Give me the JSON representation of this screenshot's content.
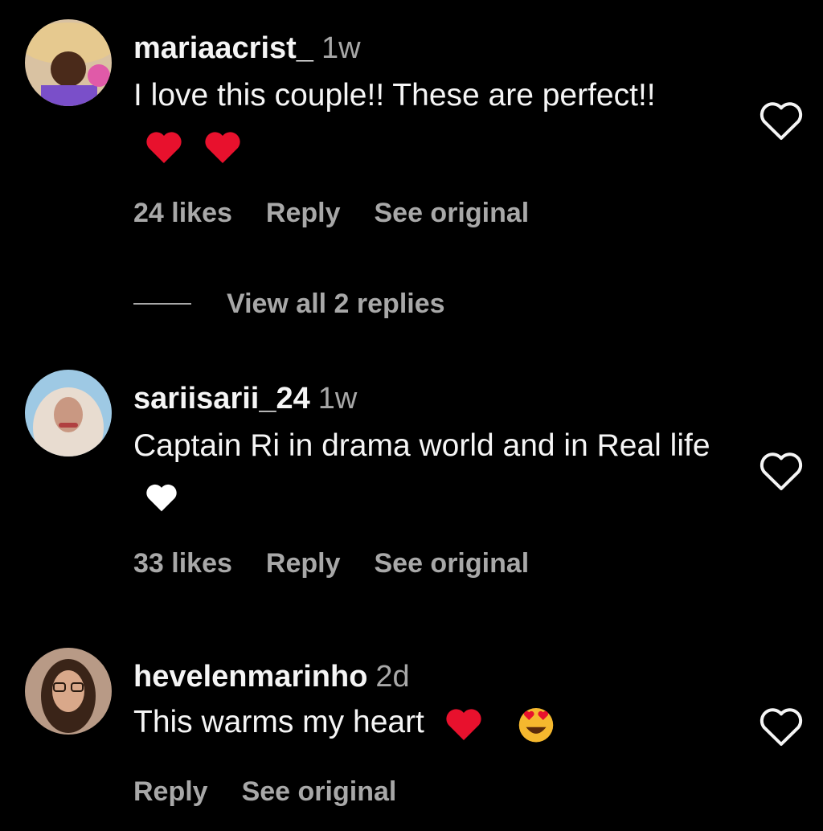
{
  "comments": [
    {
      "username": "mariaacrist_",
      "time": "1w",
      "text": "I love this couple!! These are perfect!!",
      "likes": "24 likes",
      "reply": "Reply",
      "see_original": "See original"
    },
    {
      "username": "sariisarii_24",
      "time": "1w",
      "text": "Captain Ri in drama world and in Real life",
      "likes": "33 likes",
      "reply": "Reply",
      "see_original": "See original"
    },
    {
      "username": "hevelenmarinho",
      "time": "2d",
      "text": "This warms my heart",
      "reply": "Reply",
      "see_original": "See original"
    }
  ],
  "view_replies": "View all 2 replies",
  "colors": {
    "background": "#000000",
    "primary_text": "#f5f5f5",
    "secondary_text": "#a8a8a8",
    "red_heart": "#e8112d"
  }
}
